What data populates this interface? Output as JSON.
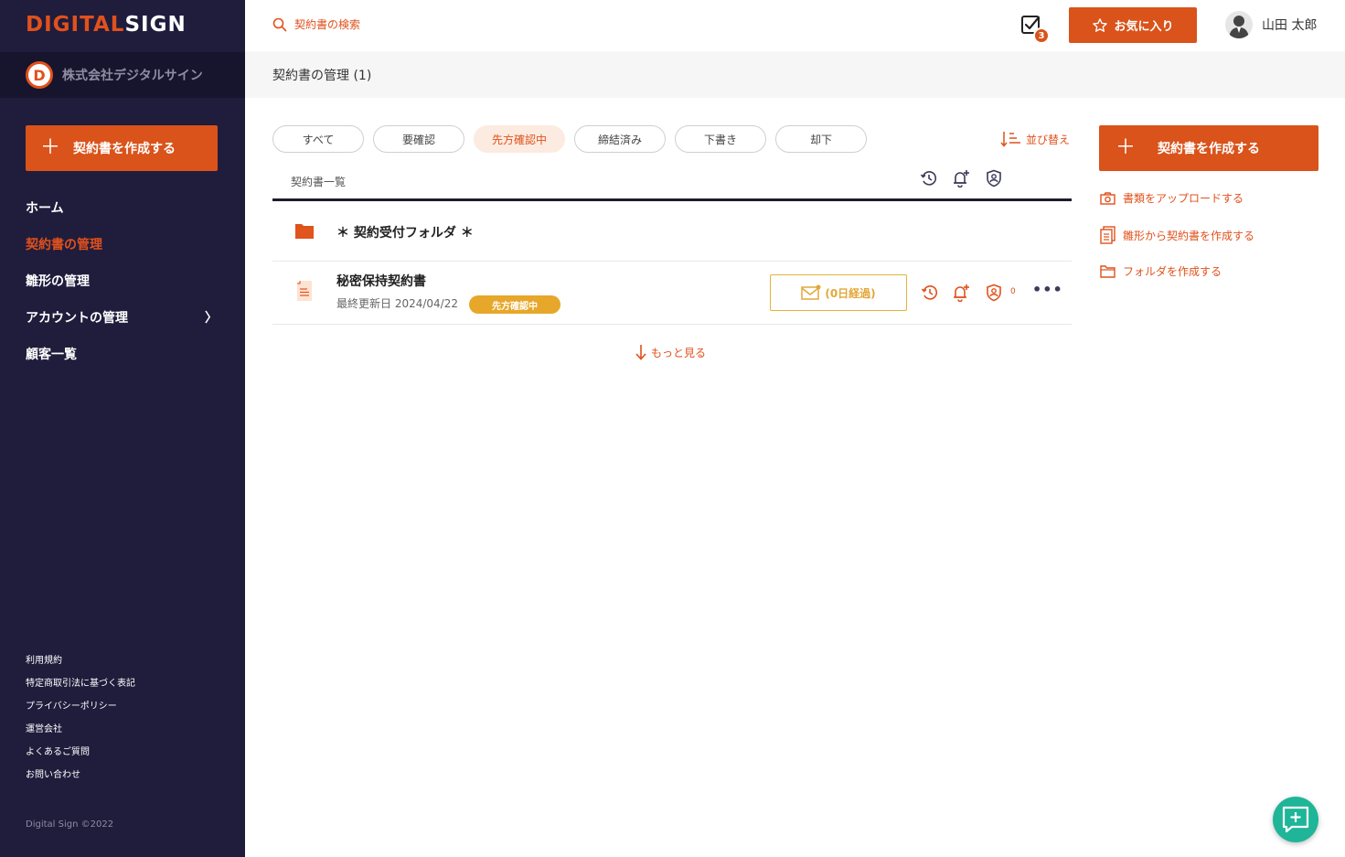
{
  "brand": {
    "part1": "DIGITAL",
    "part2": "SIGN"
  },
  "company": {
    "initial": "D",
    "name": "株式会社デジタルサイン"
  },
  "sidebar": {
    "create_label": "契約書を作成する",
    "nav": [
      {
        "label": "ホーム",
        "active": false
      },
      {
        "label": "契約書の管理",
        "active": true
      },
      {
        "label": "雛形の管理",
        "active": false
      },
      {
        "label": "アカウントの管理",
        "active": false
      },
      {
        "label": "顧客一覧",
        "active": false
      }
    ],
    "footer_links": [
      "利用規約",
      "特定商取引法に基づく表記",
      "プライバシーポリシー",
      "運営会社",
      "よくあるご質問",
      "お問い合わせ"
    ],
    "copyright": "Digital Sign ©2022"
  },
  "header": {
    "search_placeholder": "契約書の検索",
    "task_badge": "3",
    "favorite_label": "お気に入り",
    "user_name": "山田 太郎"
  },
  "page": {
    "title": "契約書の管理 (1)"
  },
  "filters": [
    {
      "label": "すべて",
      "active": false
    },
    {
      "label": "要確認",
      "active": false
    },
    {
      "label": "先方確認中",
      "active": true
    },
    {
      "label": "締結済み",
      "active": false
    },
    {
      "label": "下書き",
      "active": false
    },
    {
      "label": "却下",
      "active": false
    }
  ],
  "sort_label": "並び替え",
  "list": {
    "header": "契約書一覧",
    "folder": {
      "name": "＊ 契約受付フォルダ ＊"
    },
    "document": {
      "name": "秘密保持契約書",
      "updated": "最終更新日 2024/04/22",
      "status": "先方確認中",
      "elapsed": "(0日経過)",
      "approval_count": "0"
    },
    "show_more": "もっと見る"
  },
  "right_panel": {
    "create_label": "契約書を作成する",
    "links": [
      "書類をアップロードする",
      "雛形から契約書を作成する",
      "フォルダを作成する"
    ]
  },
  "colors": {
    "accent": "#d9531b",
    "sidebar": "#201c3c",
    "status": "#e7a72a",
    "chat": "#1fb599"
  }
}
